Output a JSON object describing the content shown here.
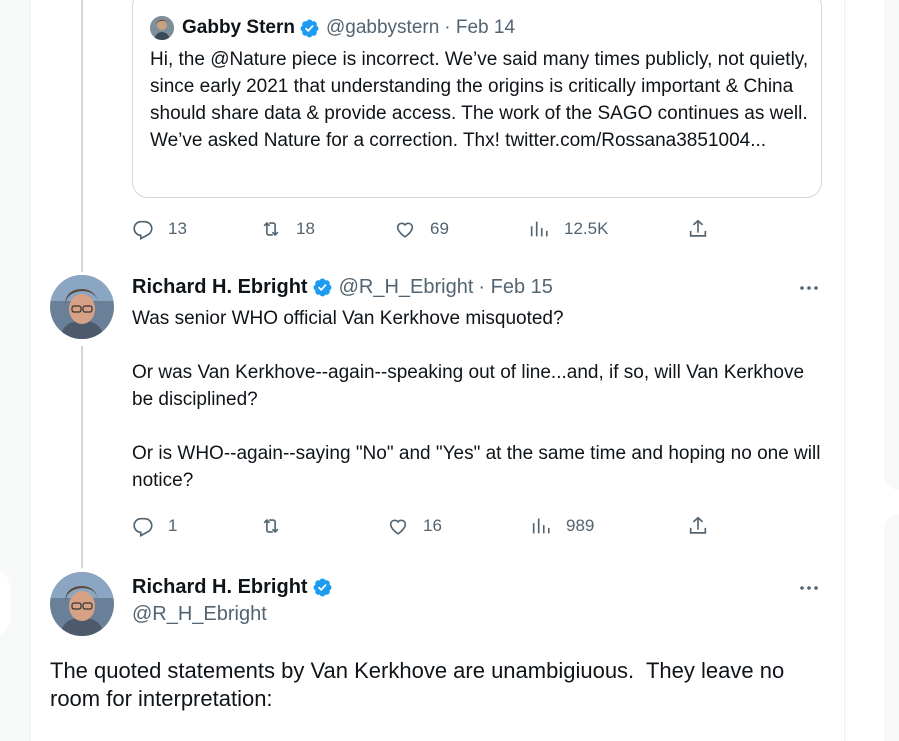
{
  "quoted_tweet": {
    "name": "Gabby Stern",
    "handle": "@gabbystern",
    "date": "· Feb 14",
    "text": "Hi, the @Nature piece is incorrect. We’ve said many times publicly, not quietly, since early 2021 that understanding the origins is critically important & China should share data & provide access. The work of the SAGO continues as well. We’ve asked Nature for a correction. Thx! twitter.com/Rossana3851004..."
  },
  "tweet1_actions": {
    "replies": "13",
    "retweets": "18",
    "likes": "69",
    "views": "12.5K"
  },
  "tweet2": {
    "name": "Richard H. Ebright",
    "handle": "@R_H_Ebright",
    "date": "· Feb 15",
    "text": "Was senior WHO official Van Kerkhove misquoted?\n\nOr was Van Kerkhove--again--speaking out of line...and, if so, will Van Kerkhove be disciplined?\n\nOr is WHO--again--saying \"No\" and \"Yes\" at the same time and hoping no one will notice?",
    "replies": "1",
    "retweets": "",
    "likes": "16",
    "views": "989"
  },
  "tweet3": {
    "name": "Richard H. Ebright",
    "handle": "@R_H_Ebright",
    "text": "The quoted statements by Van Kerkhove are unambigiuous.  They leave no room for interpretation:"
  },
  "icons": {
    "reply": "reply-icon",
    "retweet": "retweet-icon",
    "like": "heart-icon",
    "views": "views-icon",
    "share": "share-icon",
    "more": "more-icon",
    "verified": "verified-badge-icon"
  },
  "colors": {
    "verified": "#1d9bf0",
    "secondary_text": "#536471",
    "thread_line": "#cfd9de"
  }
}
